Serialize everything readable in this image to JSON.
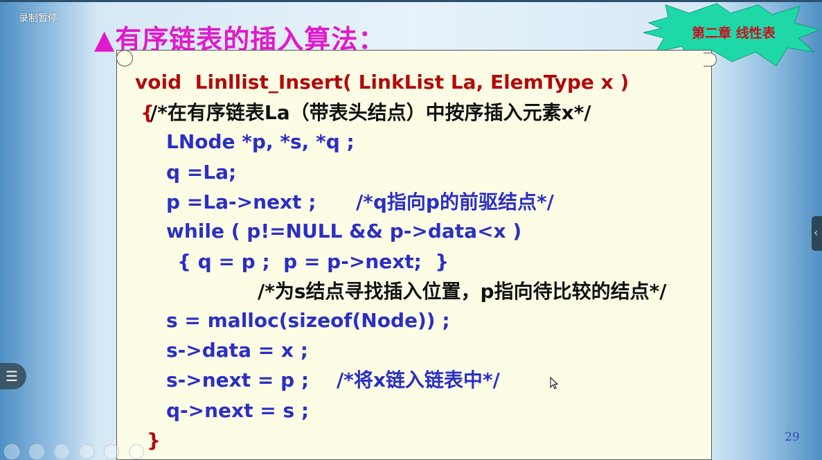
{
  "recorder": {
    "label": "录制暂停"
  },
  "slide": {
    "title": "▲有序链表的插入算法：",
    "chapter_badge": "第二章 线性表",
    "page_number": "29",
    "code": [
      {
        "text": "void  Linllist_Insert( LinkList La, ElemType x )",
        "color": "red"
      },
      {
        "text": "{",
        "color": "red"
      },
      {
        "text": "/*在有序链表La（带表头结点）中按序插入元素x*/",
        "color": "black"
      },
      {
        "text": "LNode *p, *s, *q ;",
        "color": "blue"
      },
      {
        "text": "q =La;",
        "color": "blue"
      },
      {
        "text": "p =La->next ;",
        "color": "blue"
      },
      {
        "text": "/*q指向p的前驱结点*/",
        "color": "blue"
      },
      {
        "text": "while ( p!=NULL && p->data<x )",
        "color": "blue"
      },
      {
        "text": "{ q = p ;  p = p->next;  }",
        "color": "blue"
      },
      {
        "text": "/*为s结点寻找插入位置，p指向待比较的结点*/",
        "color": "black"
      },
      {
        "text": "s = malloc(sizeof(Node)) ;",
        "color": "blue"
      },
      {
        "text": "s->data = x ;",
        "color": "blue"
      },
      {
        "text": "s->next = p ;",
        "color": "blue"
      },
      {
        "text": "/*将x链入链表中*/",
        "color": "blue"
      },
      {
        "text": "q->next = s ;",
        "color": "blue"
      },
      {
        "text": "}",
        "color": "red"
      }
    ]
  },
  "controls": {
    "side_tab_icon": "chevron-left-icon",
    "menu_icon": "list-icon"
  },
  "colors": {
    "title": "#e01acb",
    "badge_fill": "#1fd8a8",
    "code_red": "#b20a0a",
    "code_blue": "#2b2fc4",
    "page_number": "#3a48b5"
  }
}
